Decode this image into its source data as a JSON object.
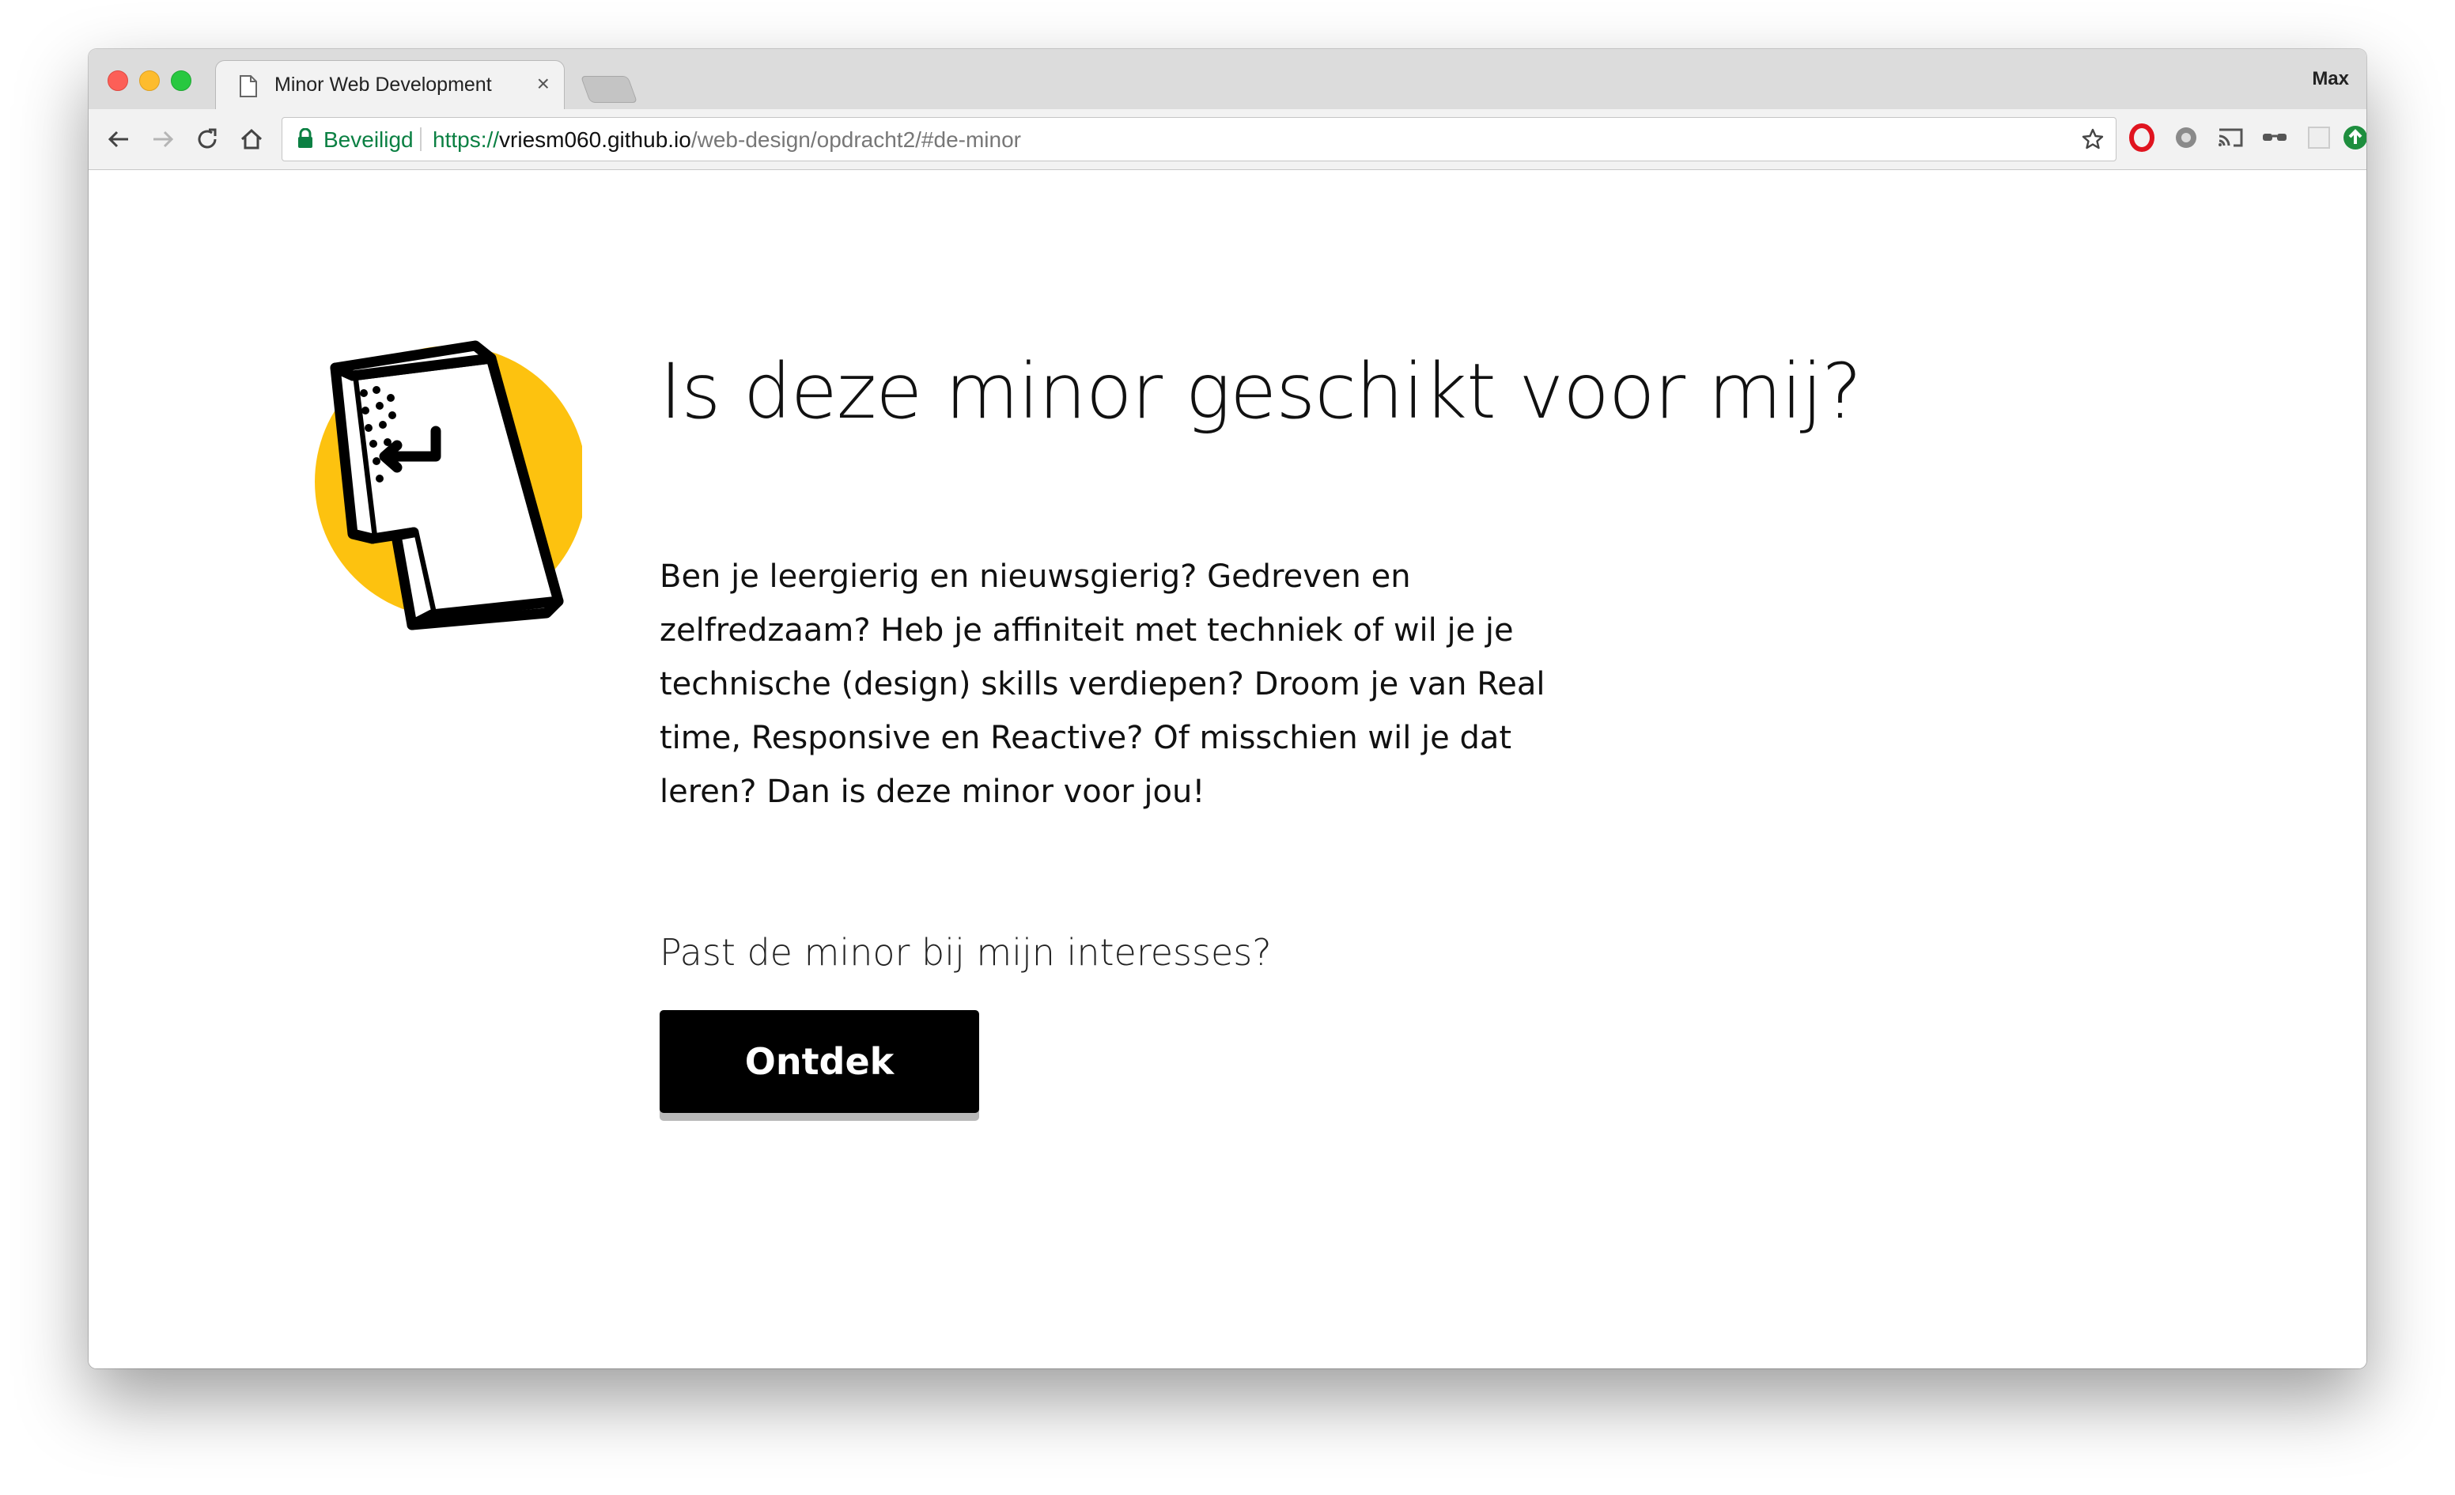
{
  "browser": {
    "tab_title": "Minor Web Development",
    "tab_close": "×",
    "profile_name": "Max",
    "security_label": "Beveiligd",
    "url_scheme": "https://",
    "url_host": "vriesm060.github.io",
    "url_path": "/web-design/opdracht2/#de-minor",
    "extensions": [
      "opera-icon",
      "settings-gear-icon",
      "cast-icon",
      "glasses-icon",
      "extension-placeholder-icon",
      "update-arrow-icon"
    ]
  },
  "page": {
    "heading": "Is deze minor geschikt voor mij?",
    "intro": "Ben je leergierig en nieuwsgierig? Gedreven en zelfredzaam? Heb je affiniteit met techniek of wil je je technische (design) skills verdiepen? Droom je van Real time, Responsive en Reactive? Of misschien wil je dat leren? Dan is deze minor voor jou!",
    "question": "Past de minor bij mijn interesses?",
    "cta_label": "Ontdek"
  },
  "colors": {
    "accent_yellow": "#fdc20f",
    "cta_background": "#000000",
    "secure_green": "#0b8043"
  }
}
